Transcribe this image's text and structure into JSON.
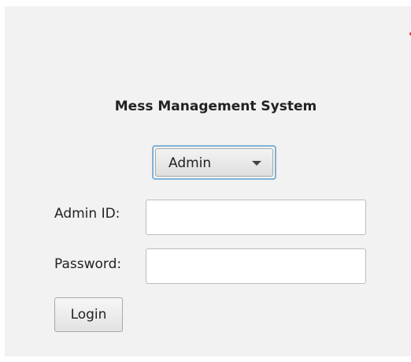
{
  "app": {
    "title": "Mess Management System"
  },
  "role_select": {
    "selected": "Admin",
    "icon": "chevron-down-icon"
  },
  "form": {
    "id_label": "Admin ID:",
    "id_value": "",
    "password_label": "Password:",
    "password_value": ""
  },
  "actions": {
    "login_label": "Login"
  },
  "colors": {
    "focus_ring": "#7fb2d9",
    "background": "#f2f2f2",
    "indicator_dot": "#e53935"
  }
}
